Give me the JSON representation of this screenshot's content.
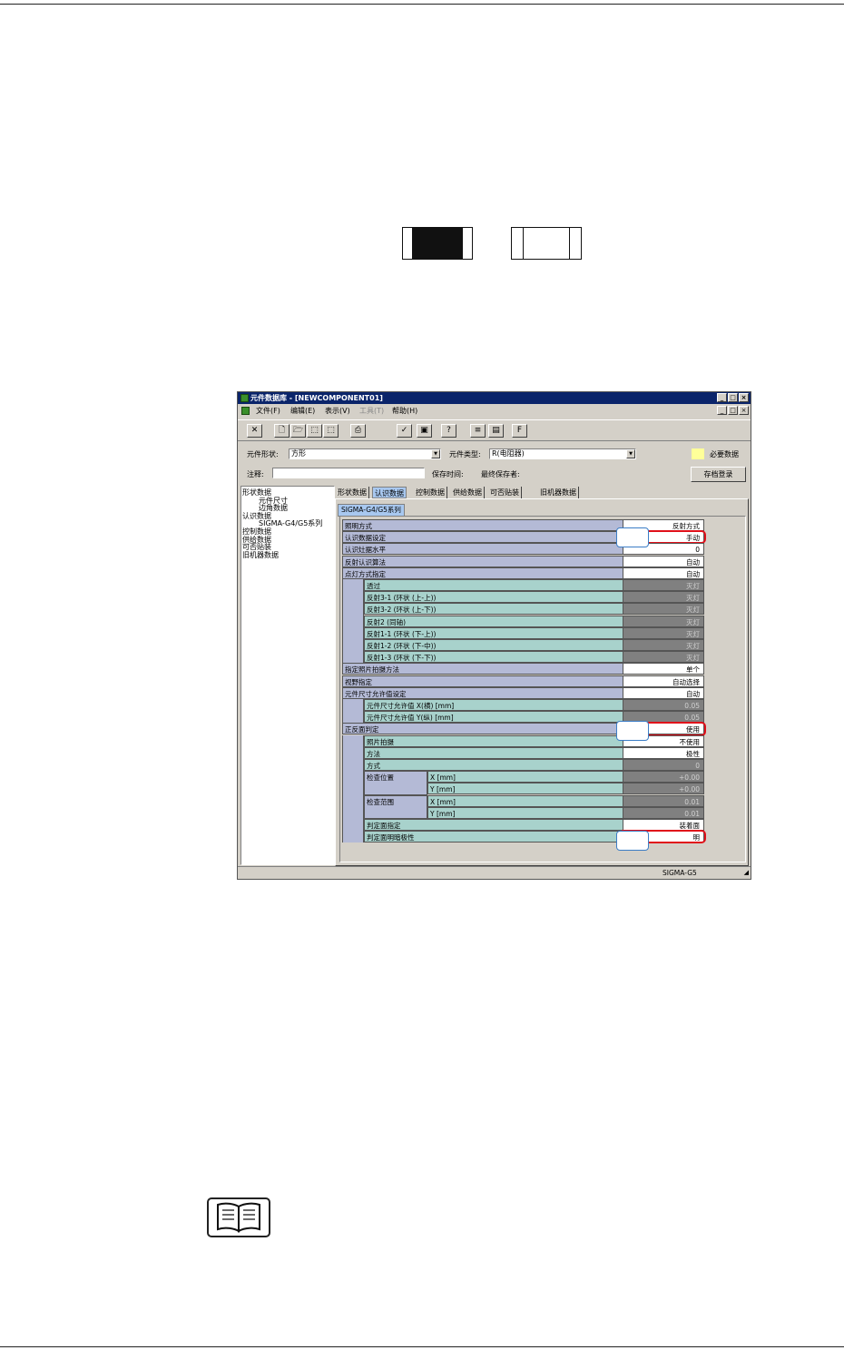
{
  "window": {
    "title": "元件数据库 - [NEWCOMPONENT01]",
    "caption_buttons": [
      "_",
      "□",
      "×"
    ],
    "menu": [
      {
        "label": "文件(F)",
        "disabled": false
      },
      {
        "label": "编辑(E)",
        "disabled": false
      },
      {
        "label": "表示(V)",
        "disabled": false
      },
      {
        "label": "工具(T)",
        "disabled": true
      },
      {
        "label": "帮助(H)",
        "disabled": false
      }
    ],
    "toolbar_glyphs": {
      "close": "✕",
      "new": "🗋",
      "open": "🗁",
      "save": "⬚",
      "export": "⬚",
      "print": "⎙",
      "check": "✓",
      "view": "▣",
      "help": "?",
      "list1": "≡",
      "list2": "▤",
      "font": "F"
    }
  },
  "form": {
    "shape_label": "元件形状:",
    "shape_value": "方形",
    "type_label": "元件类型:",
    "type_value": "R(电阻器)",
    "required_label": "必要数据",
    "comment_label": "注释:",
    "comment_value": "",
    "save_time_label": "保存时间:",
    "last_saver_label": "最终保存者:",
    "archive_button": "存档登录"
  },
  "tree": [
    {
      "label": "形状数据",
      "indent": 0
    },
    {
      "label": "元件尺寸",
      "indent": 2
    },
    {
      "label": "边角数据",
      "indent": 2
    },
    {
      "label": "认识数据",
      "indent": 0
    },
    {
      "label": "SIGMA-G4/G5系列",
      "indent": 2
    },
    {
      "label": "控制数据",
      "indent": 0
    },
    {
      "label": "供给数据",
      "indent": 0
    },
    {
      "label": "可否贴装",
      "indent": 0
    },
    {
      "label": "旧机器数据",
      "indent": 0
    }
  ],
  "tabs": [
    "形状数据",
    "认识数据",
    "控制数据",
    "供给数据",
    "可否贴装",
    "旧机器数据"
  ],
  "active_tab": 1,
  "subtab": "SIGMA-G4/G5系列",
  "rows": [
    {
      "name": "照明方式",
      "value": "反射方式",
      "level": 0,
      "gray": false
    },
    {
      "name": "认识数据设定",
      "value": "手动",
      "level": 0,
      "gray": false,
      "circled": true
    },
    {
      "name": "认识灶据水平",
      "value": "0",
      "level": 0,
      "gray": false
    },
    {
      "name": "反射认识算法",
      "value": "自动",
      "level": 0,
      "gray": false
    },
    {
      "name": "点灯方式指定",
      "value": "自动",
      "level": 0,
      "gray": false
    },
    {
      "name": "透过",
      "value": "灭灯",
      "level": 1,
      "gray": true
    },
    {
      "name": "反射3-1 (环状 (上-上))",
      "value": "灭灯",
      "level": 1,
      "gray": true
    },
    {
      "name": "反射3-2 (环状 (上-下))",
      "value": "灭灯",
      "level": 1,
      "gray": true
    },
    {
      "name": "反射2 (同轴)",
      "value": "灭灯",
      "level": 1,
      "gray": true
    },
    {
      "name": "反射1-1 (环状 (下-上))",
      "value": "灭灯",
      "level": 1,
      "gray": true
    },
    {
      "name": "反射1-2 (环状 (下-中))",
      "value": "灭灯",
      "level": 1,
      "gray": true
    },
    {
      "name": "反射1-3 (环状 (下-下))",
      "value": "灭灯",
      "level": 1,
      "gray": true
    },
    {
      "name": "指定照片拍摄方法",
      "value": "单个",
      "level": 0,
      "gray": false
    },
    {
      "name": "视野指定",
      "value": "自动选择",
      "level": 0,
      "gray": false
    },
    {
      "name": "元件尺寸允许值设定",
      "value": "自动",
      "level": 0,
      "gray": false
    },
    {
      "name": "元件尺寸允许值 X(横) [mm]",
      "value": "0.05",
      "level": 1,
      "gray": true
    },
    {
      "name": "元件尺寸允许值 Y(纵) [mm]",
      "value": "0.05",
      "level": 1,
      "gray": true
    },
    {
      "name": "正反面判定",
      "value": "使用",
      "level": 0,
      "gray": false,
      "circled": true
    },
    {
      "name": "照片拍摄",
      "value": "不使用",
      "level": 1,
      "gray": false
    },
    {
      "name": "方法",
      "value": "极性",
      "level": 1,
      "gray": false
    },
    {
      "name": "方式",
      "value": "0",
      "level": 1,
      "gray": true
    },
    {
      "name": "X [mm]",
      "value": "+0.00",
      "level": 2,
      "gray": true
    },
    {
      "name": "Y [mm]",
      "value": "+0.00",
      "level": 2,
      "gray": true
    },
    {
      "name": "X [mm]",
      "value": "0.01",
      "level": 2,
      "gray": true
    },
    {
      "name": "Y [mm]",
      "value": "0.01",
      "level": 2,
      "gray": true
    },
    {
      "name": "判定面指定",
      "value": "装着面",
      "level": 1,
      "gray": false
    },
    {
      "name": "判定面明暗极性",
      "value": "明",
      "level": 1,
      "gray": false,
      "circled": true
    }
  ],
  "group_labels": {
    "check_position": "检查位置",
    "check_range": "检查范围"
  },
  "status": {
    "model": "SIGMA-G5"
  }
}
